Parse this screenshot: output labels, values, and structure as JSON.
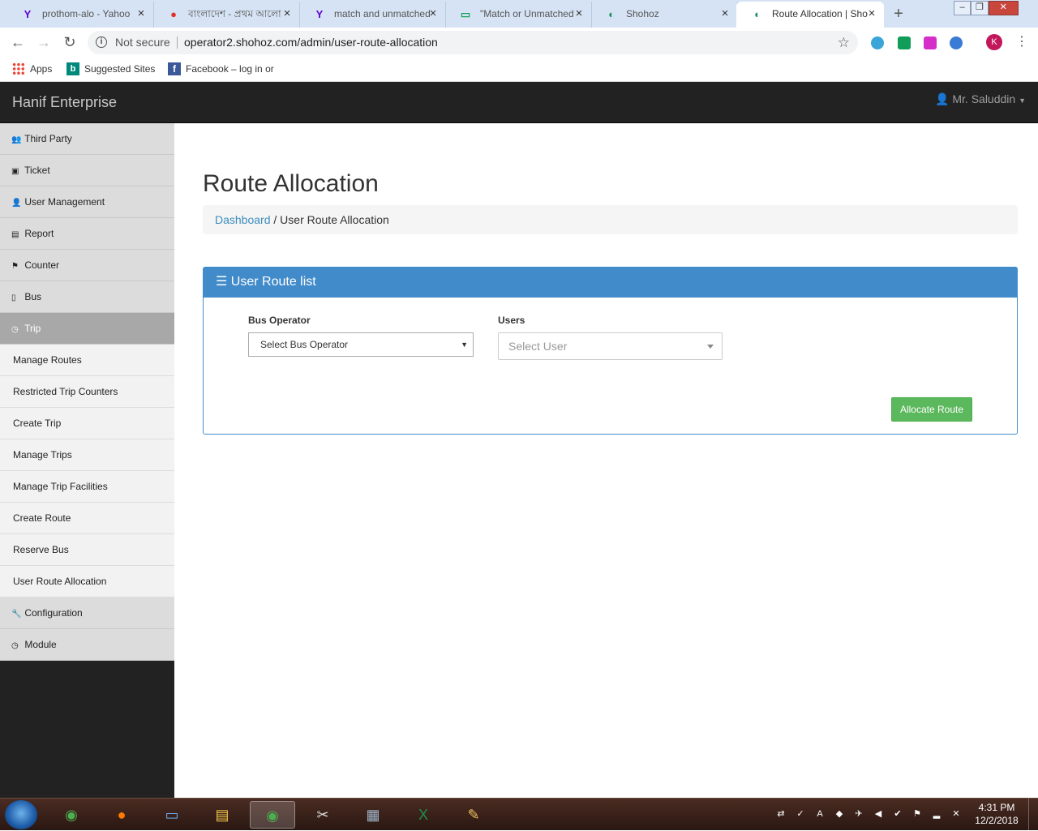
{
  "browser": {
    "tabs": [
      {
        "title": "prothom-alo - Yahoo",
        "icon": "yahoo-icon",
        "glyph": "Y",
        "color": "#5f01d1"
      },
      {
        "title": "বাংলাদেশ - প্রথম আলো",
        "icon": "prothom-alo-icon",
        "glyph": "●",
        "color": "#e0322d"
      },
      {
        "title": "match and unmatched",
        "icon": "yahoo-icon",
        "glyph": "Y",
        "color": "#5f01d1"
      },
      {
        "title": "\"Match or Unmatched",
        "icon": "document-icon",
        "glyph": "▭",
        "color": "#1ba35f"
      },
      {
        "title": "Shohoz",
        "icon": "shohoz-icon",
        "glyph": "◐",
        "color": "#1a8c5a"
      },
      {
        "title": "Route Allocation | Sho",
        "icon": "shohoz-icon",
        "glyph": "◐",
        "color": "#1a8c5a",
        "active": true
      }
    ],
    "not_secure": "Not secure",
    "url": "operator2.shohoz.com/admin/user-route-allocation",
    "profile_initial": "K",
    "bookmarks": [
      {
        "label": "Apps",
        "icon": "apps-grid-icon"
      },
      {
        "label": "Suggested Sites",
        "icon": "bing-icon"
      },
      {
        "label": "Facebook – log in or",
        "icon": "facebook-icon"
      }
    ]
  },
  "app": {
    "brand": "Hanif Enterprise",
    "user": "Mr. Saluddin",
    "sidebar": {
      "items": [
        {
          "label": "Third Party",
          "icon": "users-icon",
          "glyph": "👥"
        },
        {
          "label": "Ticket",
          "icon": "ticket-icon",
          "glyph": "▣"
        },
        {
          "label": "User Management",
          "icon": "user-icon",
          "glyph": "👤"
        },
        {
          "label": "Report",
          "icon": "report-icon",
          "glyph": "▤"
        },
        {
          "label": "Counter",
          "icon": "flag-icon",
          "glyph": "⚑"
        },
        {
          "label": "Bus",
          "icon": "bus-icon",
          "glyph": "▯"
        },
        {
          "label": "Trip",
          "icon": "clock-icon",
          "glyph": "◷",
          "active": true
        }
      ],
      "sub_items": [
        "Manage Routes",
        "Restricted Trip Counters",
        "Create Trip",
        "Manage Trips",
        "Manage Trip Facilities",
        "Create Route",
        "Reserve Bus",
        "User Route Allocation"
      ],
      "bottom_items": [
        {
          "label": "Configuration",
          "icon": "wrench-icon",
          "glyph": "🔧"
        },
        {
          "label": "Module",
          "icon": "clock-icon",
          "glyph": "◷"
        }
      ]
    },
    "page_title": "Route Allocation",
    "breadcrumb": {
      "link": "Dashboard",
      "separator": "/",
      "current": "User Route Allocation"
    },
    "panel": {
      "title": "User Route list",
      "bus_operator_label": "Bus Operator",
      "bus_operator_value": "Select Bus Operator",
      "users_label": "Users",
      "users_placeholder": "Select User",
      "allocate_button": "Allocate Route"
    }
  },
  "taskbar": {
    "apps": [
      "chrome-icon",
      "firefox-icon",
      "remote-desktop-icon",
      "file-explorer-icon",
      "chrome-icon",
      "snipping-tool-icon",
      "network-icon",
      "excel-icon",
      "paint-icon"
    ],
    "time": "4:31 PM",
    "date": "12/2/2018"
  }
}
